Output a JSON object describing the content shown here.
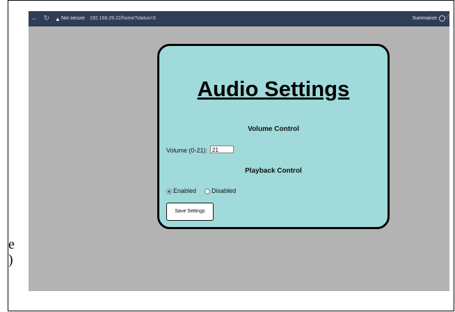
{
  "browser": {
    "back_icon": "back-arrow-icon",
    "reload_icon": "reload-icon",
    "warning_icon": "warning-icon",
    "security_label": "Not secure",
    "url": "192.168.29.22/home?status=3",
    "summarize_label": "Summarize"
  },
  "page": {
    "title": "Audio Settings",
    "volume_section": "Volume Control",
    "volume_label": "Volume (0-21):",
    "volume_value": "21",
    "playback_section": "Playback Control",
    "enabled_label": "Enabled",
    "disabled_label": "Disabled",
    "enabled_selected": true,
    "save_label": "Save Settings"
  },
  "outside": {
    "line1": "e",
    "line2": ")"
  },
  "colors": {
    "card": "#a0dada",
    "page_background": "#b3b3b3",
    "browser_bar": "#2f3d56"
  }
}
